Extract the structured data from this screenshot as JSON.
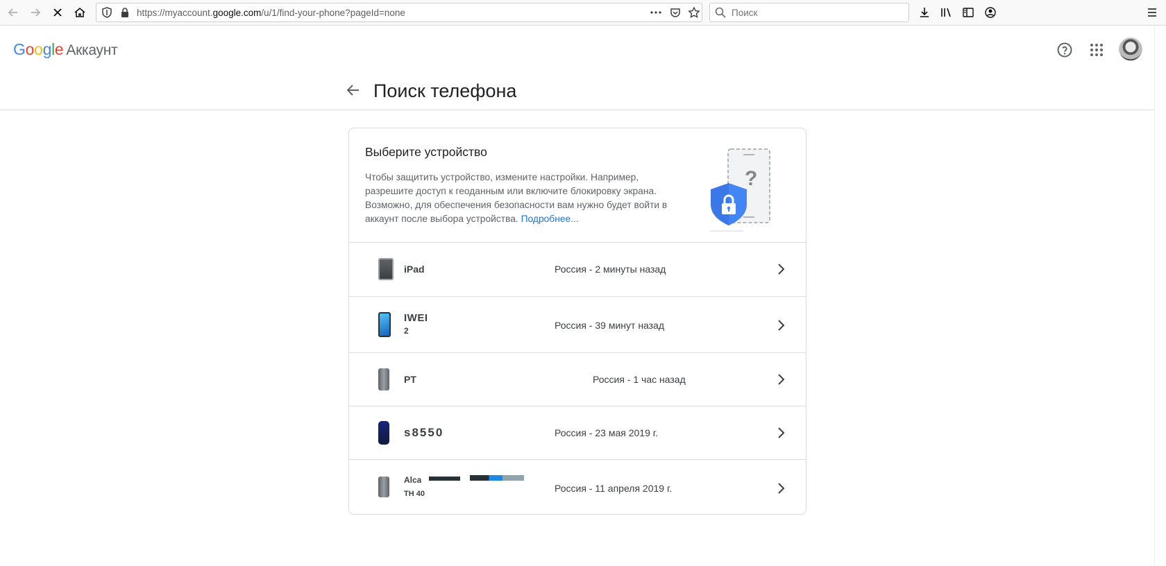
{
  "browser": {
    "url_prefix": "https://myaccount.",
    "url_domain": "google.com",
    "url_suffix": "/u/1/find-your-phone?pageId=none",
    "search_placeholder": "Поиск"
  },
  "header": {
    "logo_letters": [
      "G",
      "o",
      "o",
      "g",
      "l",
      "e"
    ],
    "product": "Аккаунт"
  },
  "page": {
    "title": "Поиск телефона"
  },
  "intro": {
    "title": "Выберите устройство",
    "text": "Чтобы защитить устройство, измените настройки. Например, разрешите доступ к геоданным или включите блокировку экрана. Возможно, для обеспечения безопасности вам нужно будет войти в аккаунт после выбора устройства.",
    "link": "Подробнее..."
  },
  "devices": [
    {
      "name": "iPad",
      "name_line2": "",
      "country": "Россия",
      "time": "2 минуты назад"
    },
    {
      "name": "IWEI",
      "name_line2": "2",
      "country": "Россия",
      "time": "39 минут назад"
    },
    {
      "name": "PT",
      "name_line2": "",
      "country": "Россия",
      "time": "1 час назад"
    },
    {
      "name": "s8550",
      "name_line2": "",
      "country": "Россия",
      "time": "23 мая 2019 г."
    },
    {
      "name": "Alca",
      "name_line2": "TH 40",
      "country": "Россия",
      "time": "11 апреля 2019 г."
    }
  ],
  "colors": {
    "accent": "#1a73e8",
    "shield": "#4285f4",
    "divider": "#dadce0"
  }
}
